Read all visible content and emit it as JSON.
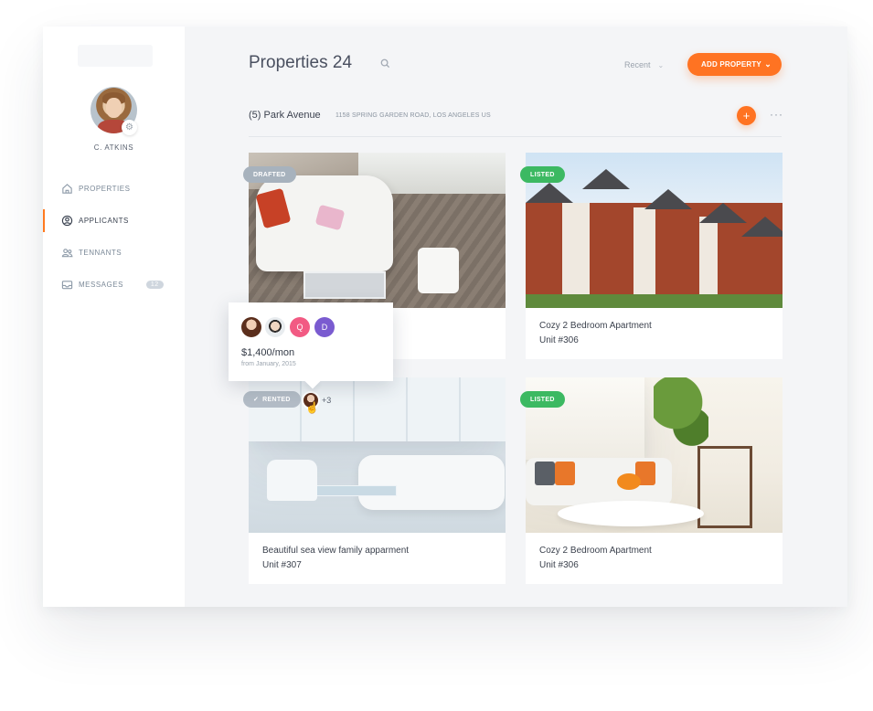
{
  "user": {
    "name": "C. ATKINS"
  },
  "sidebar": {
    "items": [
      {
        "label": "PROPERTIES",
        "icon": "home-icon"
      },
      {
        "label": "APPLICANTS",
        "icon": "user-circle-icon",
        "active": true
      },
      {
        "label": "TENNANTS",
        "icon": "users-icon"
      },
      {
        "label": "MESSAGES",
        "icon": "inbox-icon",
        "badge": "12"
      }
    ]
  },
  "header": {
    "title": "Properties 24",
    "sort_label": "Recent",
    "add_label": "ADD PROPERTY"
  },
  "group": {
    "name": "(5) Park Avenue",
    "address": "1158 SPRING GARDEN ROAD, LOS ANGELES US"
  },
  "cards": [
    {
      "badge": "DRAFTED",
      "title": "",
      "unit": ""
    },
    {
      "badge": "LISTED",
      "title": "Cozy 2 Bedroom Apartment",
      "unit": "Unit #306"
    },
    {
      "badge": "RENTED",
      "title": "Beautiful sea view family apparment",
      "unit": "Unit #307",
      "extra_count": "+3"
    },
    {
      "badge": "LISTED",
      "title": "Cozy 2 Bedroom Apartment",
      "unit": "Unit #306"
    }
  ],
  "popover": {
    "initials": [
      "Q",
      "D"
    ],
    "price": "$1,400/mon",
    "since": "from January, 2015"
  },
  "colors": {
    "accent": "#ff7322",
    "listed": "#3cb962",
    "drafted": "#a7b2bd",
    "rented": "#b3bcc6"
  }
}
